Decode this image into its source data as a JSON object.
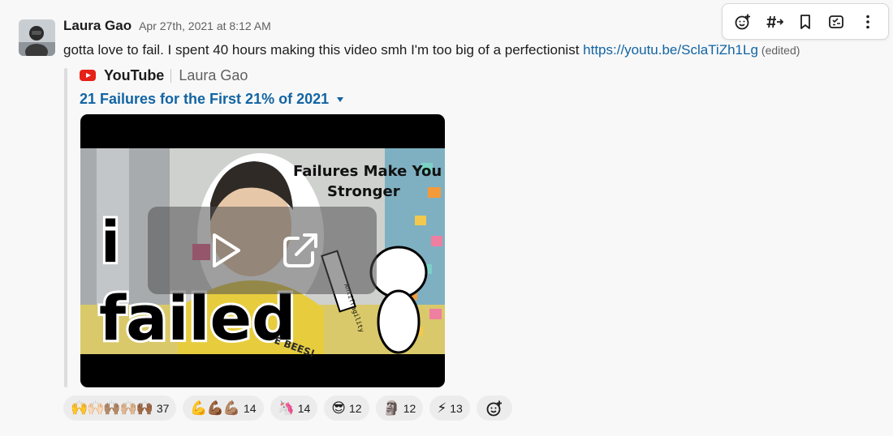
{
  "message": {
    "author": "Laura Gao",
    "timestamp": "Apr 27th, 2021 at 8:12 AM",
    "text": "gotta love to fail. I spent 40 hours making this video smh I'm too big of a perfectionist ",
    "link": "https://youtu.be/SclaTiZh1Lg",
    "edited": "(edited)"
  },
  "toolbar": {
    "icons": [
      "add-reaction-icon",
      "reply-in-thread-icon",
      "bookmark-icon",
      "share-icon",
      "more-actions-icon"
    ]
  },
  "attachment": {
    "service": "YouTube",
    "channel": "Laura Gao",
    "title": "21 Failures for the First 21% of 2021",
    "thumbnail": {
      "line1": "Failures Make You",
      "line2": "Stronger",
      "big_i": "i",
      "big_failed": "failed",
      "note_label": "Antifragility",
      "shirt_text": "E BEES!"
    }
  },
  "reactions": [
    {
      "emoji": "🙌🙌🏻🙌🏽🙌🏼🙌🏾",
      "count": "37"
    },
    {
      "emoji": "💪💪🏾💪🏽",
      "count": "14"
    },
    {
      "emoji": "🦄",
      "count": "14"
    },
    {
      "emoji": "😎",
      "count": "12"
    },
    {
      "emoji": "🗿",
      "count": "12"
    },
    {
      "emoji": "⚡",
      "count": "13"
    }
  ],
  "colors": {
    "link": "#1264a3",
    "youtube": "#e62117",
    "pill": "#ececec",
    "background": "#f8f8f8"
  }
}
